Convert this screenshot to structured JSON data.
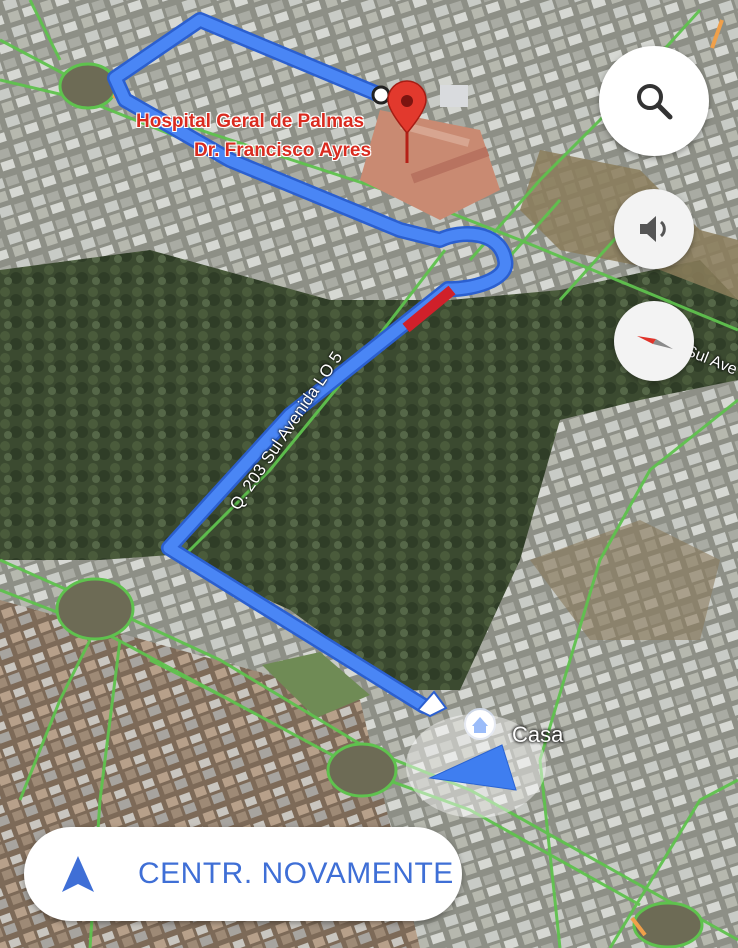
{
  "map": {
    "type": "satellite-navigation",
    "destination": {
      "name_line1": "Hospital Geral de Palmas",
      "name_line2": "Dr. Francisco Ayres",
      "icon": "red-map-pin-icon"
    },
    "origin": {
      "name": "Casa",
      "icon": "home-icon"
    },
    "streets": {
      "main": "Q. 203 Sul Avenida LO 5",
      "partial": "Sul Ave"
    },
    "route_color": "#4a86f5",
    "traffic_color": "#d0202a",
    "nav_arrow_color": "#3f7ef0"
  },
  "controls": {
    "search_icon": "search-icon",
    "sound_icon": "speaker-icon",
    "compass_icon": "compass-icon",
    "recenter_label": "CENTR. NOVAMENTE",
    "recenter_icon": "navigation-arrow-icon"
  }
}
